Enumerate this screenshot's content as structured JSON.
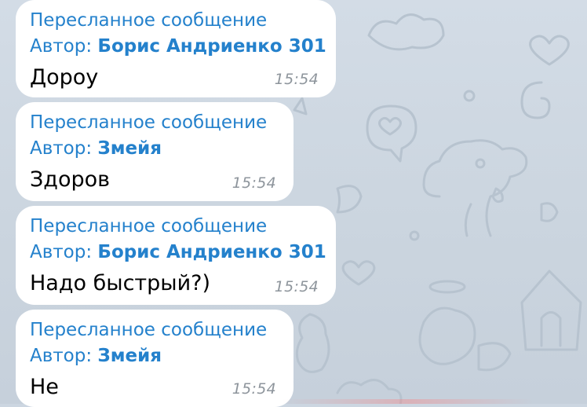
{
  "messages": [
    {
      "forward_label": "Пересланное сообщение",
      "author_prefix": "Автор: ",
      "author": "Борис Андриенко 301",
      "text": "Дороу",
      "time": "15:54"
    },
    {
      "forward_label": "Пересланное сообщение",
      "author_prefix": "Автор: ",
      "author": "Змейя",
      "text": "Здоров",
      "time": "15:54"
    },
    {
      "forward_label": "Пересланное сообщение",
      "author_prefix": "Автор: ",
      "author": "Борис Андриенко 301",
      "text": "Надо быстрый?)",
      "time": "15:54"
    },
    {
      "forward_label": "Пересланное сообщение",
      "author_prefix": "Автор: ",
      "author": "Змейя",
      "text": "Не",
      "time": "15:54"
    }
  ],
  "colors": {
    "background": "#ccd6e1",
    "bubble": "#ffffff",
    "forward_accent": "#2481cc",
    "time": "#8e959c",
    "text": "#000000"
  },
  "icons": [
    "heart-doodle",
    "dog-doodle",
    "doghouse-doodle",
    "cloud-doodle",
    "bone-doodle"
  ]
}
